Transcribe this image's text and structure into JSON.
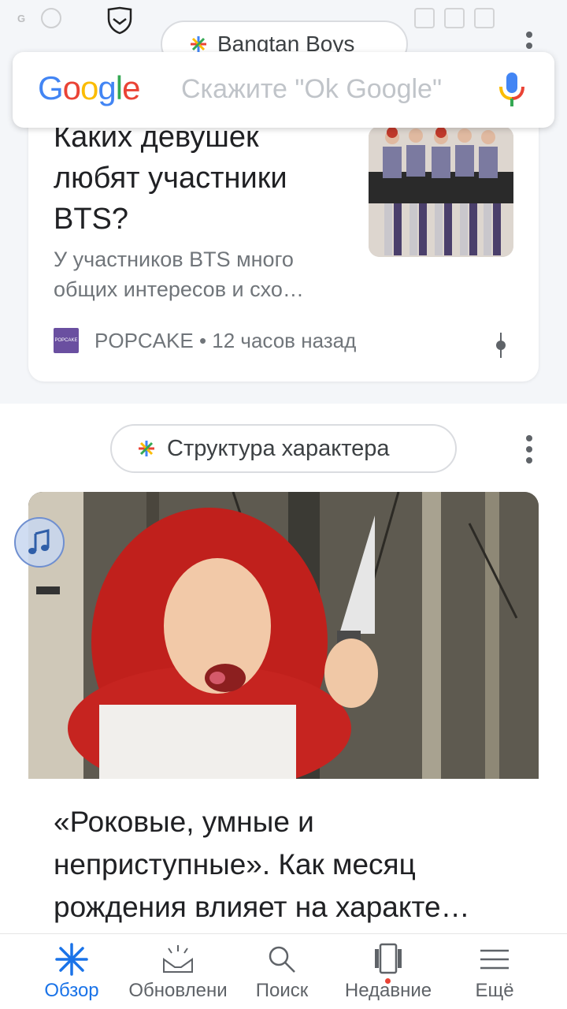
{
  "status_bar": {
    "signal_text": "G"
  },
  "top_topic": {
    "label": "Bangtan Boys"
  },
  "search": {
    "placeholder": "Скажите \"Ok Google\""
  },
  "card1": {
    "title": "Каких девушек любят участники BTS?",
    "snippet": "У участников BTS много общих интересов и схо…",
    "source": "POPCAKE",
    "time": "• 12 часов назад",
    "favicon_text": "POPCAKE"
  },
  "section2": {
    "topic": "Структура характера"
  },
  "card2": {
    "title": "«Роковые, умные и неприступные». Как месяц рождения влияет на характе…"
  },
  "nav": [
    {
      "label": "Обзор",
      "icon": "asterisk-icon",
      "active": true
    },
    {
      "label": "Обновлени",
      "icon": "updates-icon"
    },
    {
      "label": "Поиск",
      "icon": "search-icon"
    },
    {
      "label": "Недавние",
      "icon": "recent-icon"
    },
    {
      "label": "Ещё",
      "icon": "menu-icon"
    }
  ],
  "colors": {
    "accent": "#1a73e8",
    "google_blue": "#4285f4",
    "google_red": "#ea4335",
    "google_yellow": "#fbbc05",
    "google_green": "#34a853"
  }
}
